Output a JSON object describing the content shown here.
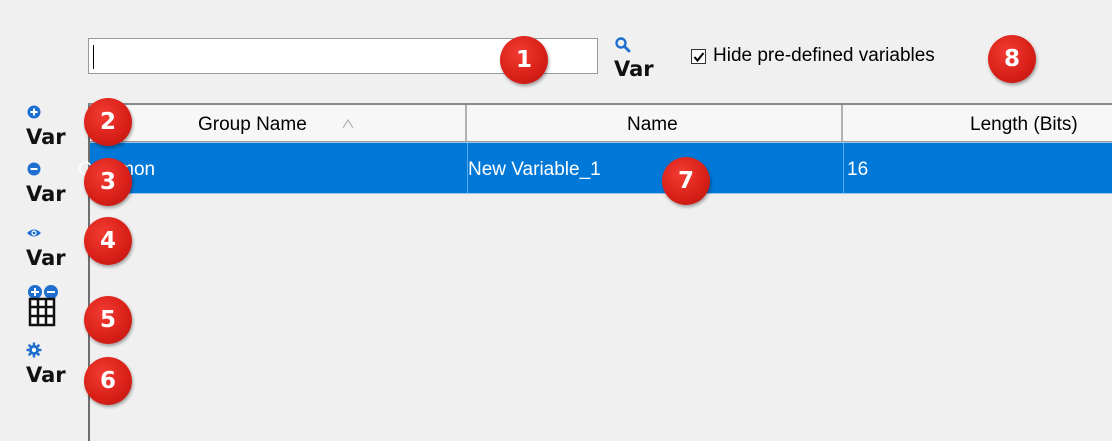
{
  "search": {
    "value": "",
    "placeholder": ""
  },
  "toolbar": {
    "search_button_label": "Var",
    "add_label": "Var",
    "remove_label": "Var",
    "view_label": "Var",
    "settings_label": "Var",
    "add_remove_table_icon": "table-add-remove-icon"
  },
  "filter": {
    "hide_predefined_label": "Hide pre-defined variables",
    "hide_predefined_checked": true
  },
  "table": {
    "columns": [
      "Group Name",
      "Name",
      "Length (Bits)"
    ],
    "sort": {
      "column": "Group Name",
      "direction": "ascending"
    },
    "rows": [
      {
        "group": "Common",
        "name": "New Variable_1",
        "length": "16",
        "selected": true
      }
    ]
  },
  "callouts": [
    "1",
    "2",
    "3",
    "4",
    "5",
    "6",
    "7",
    "8"
  ],
  "colors": {
    "selection": "#0078d7",
    "callout": "#d71f18",
    "icon_blue": "#1f6fd0"
  }
}
